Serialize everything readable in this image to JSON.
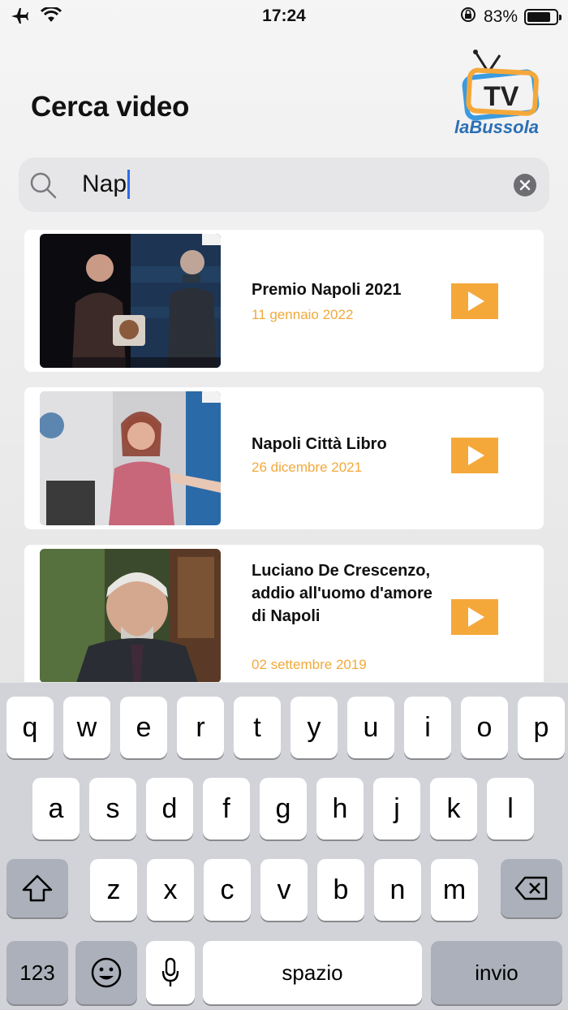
{
  "status": {
    "time": "17:24",
    "battery": "83%",
    "battery_level": 0.83
  },
  "header": {
    "title": "Cerca video",
    "logo_text_top": "TV",
    "logo_text_bottom": "laBussola"
  },
  "search": {
    "value": "Nap"
  },
  "results": [
    {
      "title": "Premio Napoli 2021",
      "date": "11 gennaio 2022"
    },
    {
      "title": "Napoli Città Libro",
      "date": "26 dicembre 2021"
    },
    {
      "title": "Luciano De Crescenzo, addio all'uomo d'amore di Napoli",
      "date": "02 settembre 2019"
    }
  ],
  "keyboard": {
    "row1": [
      "q",
      "w",
      "e",
      "r",
      "t",
      "y",
      "u",
      "i",
      "o",
      "p"
    ],
    "row2": [
      "a",
      "s",
      "d",
      "f",
      "g",
      "h",
      "j",
      "k",
      "l"
    ],
    "row3": [
      "z",
      "x",
      "c",
      "v",
      "b",
      "n",
      "m"
    ],
    "numbers_label": "123",
    "space_label": "spazio",
    "return_label": "invio"
  },
  "colors": {
    "accent": "#f5a83a",
    "date": "#f2a93b",
    "caret": "#2d6be8"
  }
}
